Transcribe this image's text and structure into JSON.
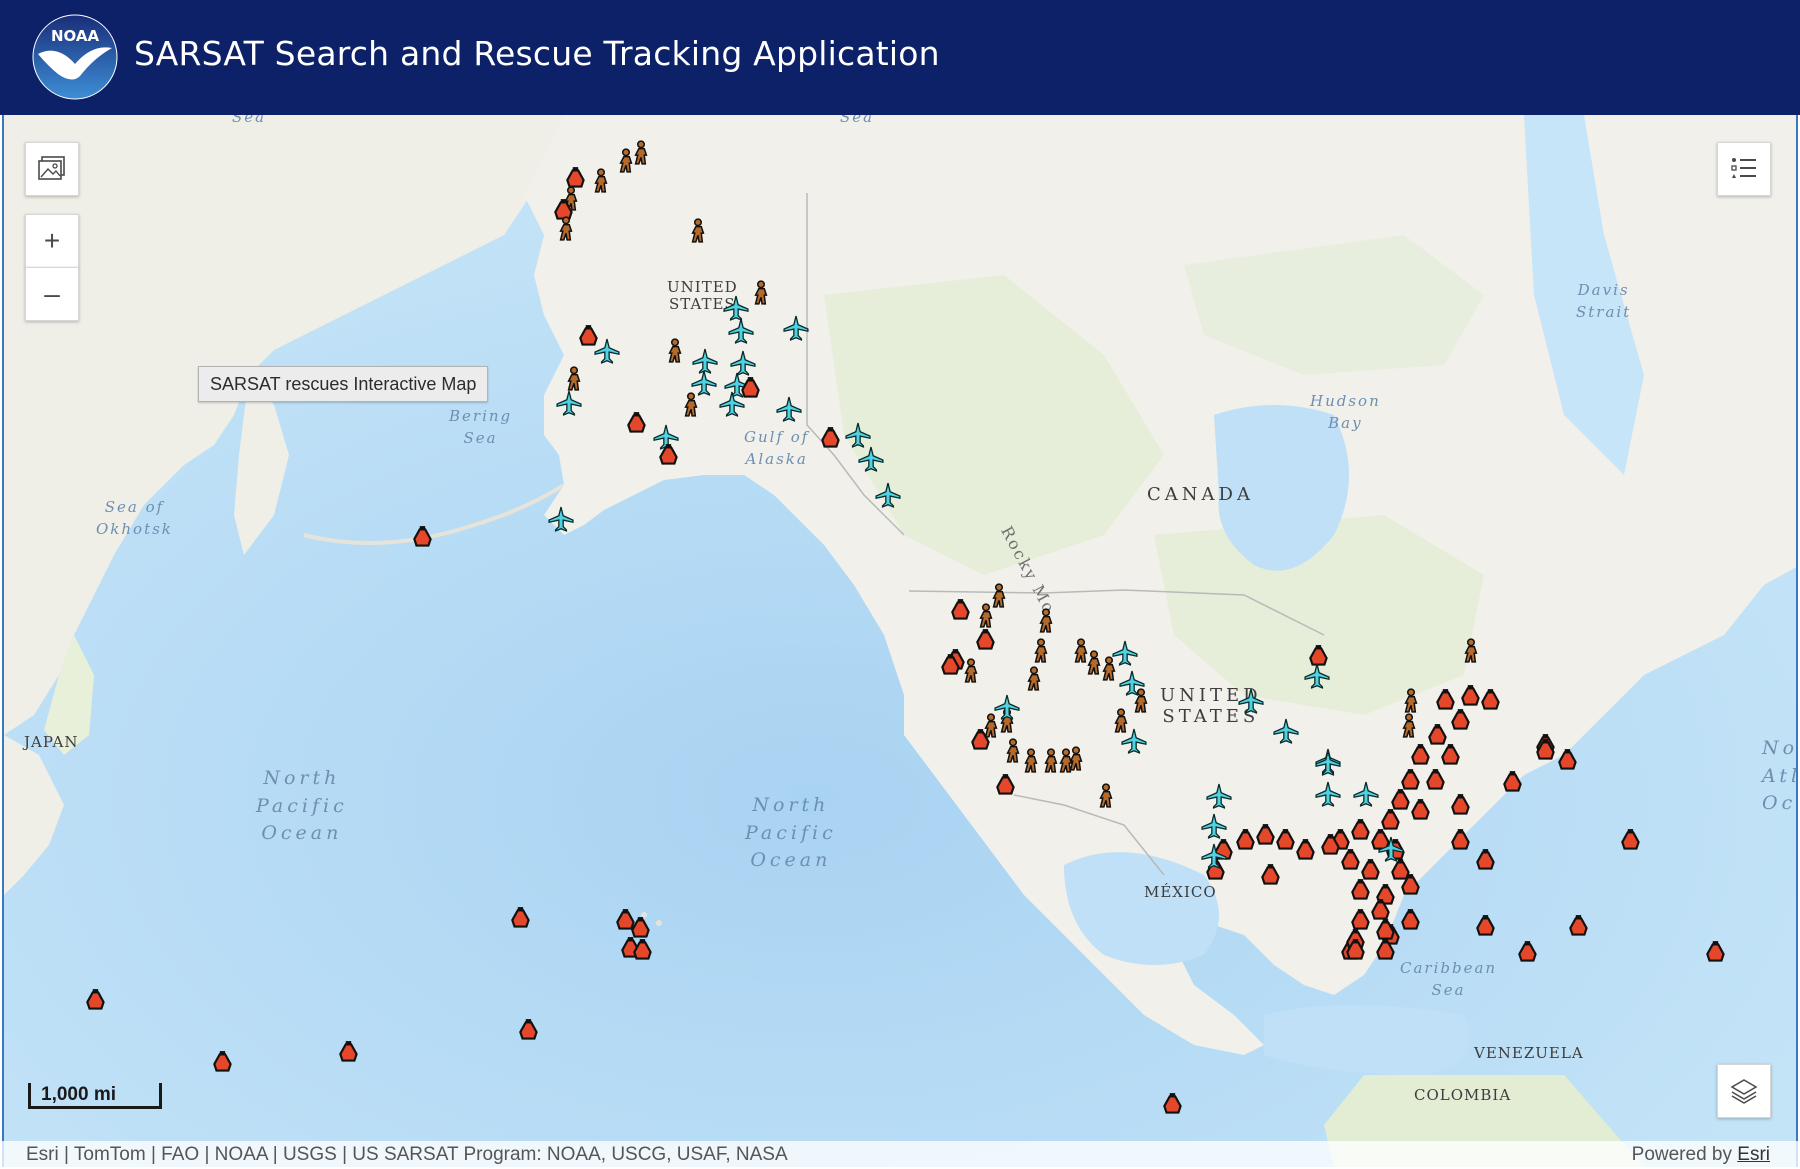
{
  "header": {
    "title": "SARSAT Search and Rescue Tracking Application",
    "logo_text": "NOAA"
  },
  "map": {
    "tooltip": "SARSAT rescues Interactive Map",
    "scale_label": "1,000 mi",
    "zoom_in_symbol": "+",
    "zoom_out_symbol": "–",
    "water_labels": {
      "sea_top_left": "Sea",
      "sea_top_mid": "Sea",
      "bering": "Bering\nSea",
      "okhotsk": "Sea of\nOkhotsk",
      "gulf_alaska": "Gulf of\nAlaska",
      "hudson": "Hudson\nBay",
      "davis": "Davis\nStrait",
      "north_pacific_west": "North\nPacific\nOcean",
      "north_pacific_east": "North\nPacific\nOcean",
      "north_atlantic": "Nor\nAtla\nOce",
      "caribbean": "Caribbean\nSea"
    },
    "country_labels": {
      "us_alaska": "UNITED\nSTATES",
      "canada": "CANADA",
      "us_main": "UNITED\nSTATES",
      "mexico": "MÉXICO",
      "japan": "JAPAN",
      "venezuela": "VENEZUELA",
      "colombia": "COLOMBIA"
    },
    "feature_labels": {
      "rocky": "Rocky Mo"
    },
    "icons": {
      "basemap": "basemap-gallery-icon",
      "legend": "legend-list-icon",
      "layers": "layer-list-icon",
      "maritime": "ship-icon",
      "aviation": "airplane-icon",
      "land": "hiker-icon"
    },
    "colors": {
      "maritime": "#e4472a",
      "aviation": "#4fd3e3",
      "land": "#b56a2a",
      "header": "#0c2168",
      "water": "#bfe0f6",
      "land_fill": "#f1f0ea"
    }
  },
  "attribution": {
    "sources": "Esri | TomTom | FAO | NOAA | USGS | US SARSAT Program: NOAA, USCG, USAF, NASA",
    "powered_prefix": "Powered by ",
    "powered_link": "Esri"
  }
}
